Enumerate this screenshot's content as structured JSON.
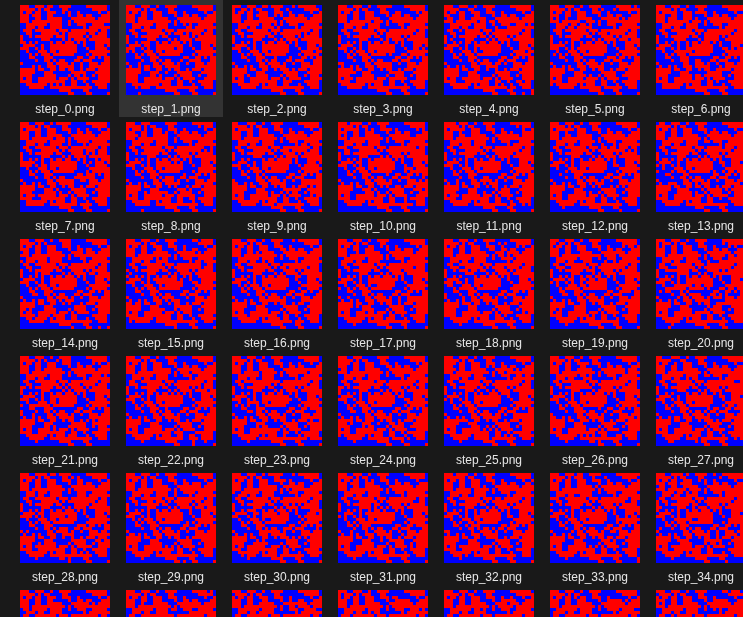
{
  "files": [
    {
      "label": "step_0.png",
      "selected": false
    },
    {
      "label": "step_1.png",
      "selected": true
    },
    {
      "label": "step_2.png",
      "selected": false
    },
    {
      "label": "step_3.png",
      "selected": false
    },
    {
      "label": "step_4.png",
      "selected": false
    },
    {
      "label": "step_5.png",
      "selected": false
    },
    {
      "label": "step_6.png",
      "selected": false
    },
    {
      "label": "step_7.png",
      "selected": false
    },
    {
      "label": "step_8.png",
      "selected": false
    },
    {
      "label": "step_9.png",
      "selected": false
    },
    {
      "label": "step_10.png",
      "selected": false
    },
    {
      "label": "step_11.png",
      "selected": false
    },
    {
      "label": "step_12.png",
      "selected": false
    },
    {
      "label": "step_13.png",
      "selected": false
    },
    {
      "label": "step_14.png",
      "selected": false
    },
    {
      "label": "step_15.png",
      "selected": false
    },
    {
      "label": "step_16.png",
      "selected": false
    },
    {
      "label": "step_17.png",
      "selected": false
    },
    {
      "label": "step_18.png",
      "selected": false
    },
    {
      "label": "step_19.png",
      "selected": false
    },
    {
      "label": "step_20.png",
      "selected": false
    },
    {
      "label": "step_21.png",
      "selected": false
    },
    {
      "label": "step_22.png",
      "selected": false
    },
    {
      "label": "step_23.png",
      "selected": false
    },
    {
      "label": "step_24.png",
      "selected": false
    },
    {
      "label": "step_25.png",
      "selected": false
    },
    {
      "label": "step_26.png",
      "selected": false
    },
    {
      "label": "step_27.png",
      "selected": false
    },
    {
      "label": "step_28.png",
      "selected": false
    },
    {
      "label": "step_29.png",
      "selected": false
    },
    {
      "label": "step_30.png",
      "selected": false
    },
    {
      "label": "step_31.png",
      "selected": false
    },
    {
      "label": "step_32.png",
      "selected": false
    },
    {
      "label": "step_33.png",
      "selected": false
    },
    {
      "label": "step_34.png",
      "selected": false
    },
    {
      "label": "",
      "selected": false
    },
    {
      "label": "",
      "selected": false
    },
    {
      "label": "",
      "selected": false
    },
    {
      "label": "",
      "selected": false
    },
    {
      "label": "",
      "selected": false
    },
    {
      "label": "",
      "selected": false
    },
    {
      "label": "",
      "selected": false
    }
  ]
}
